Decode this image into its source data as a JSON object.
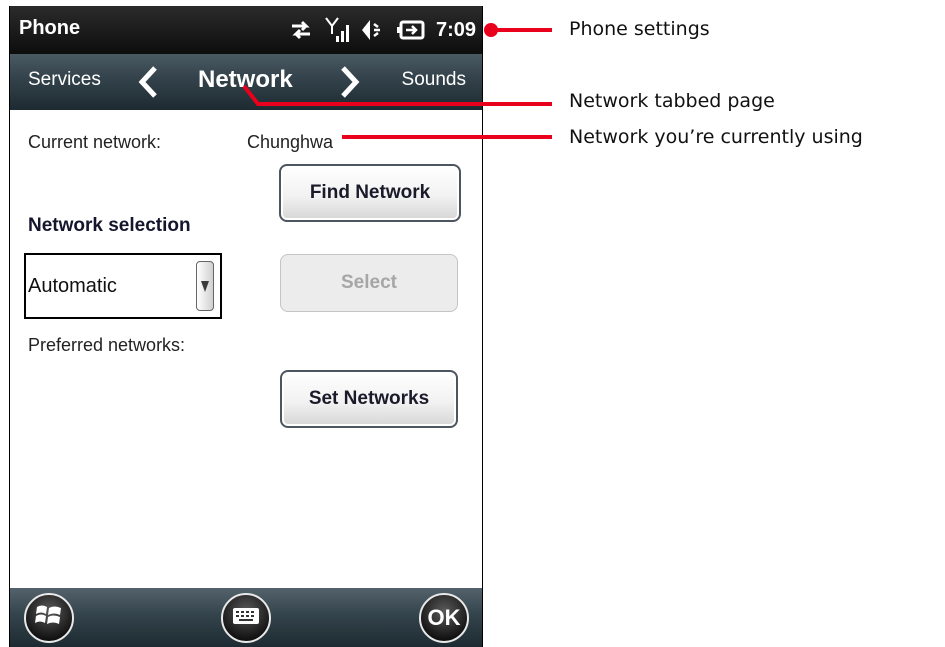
{
  "status_bar": {
    "title": "Phone",
    "time": "7:09",
    "icons": [
      "data-sync-icon",
      "signal-strength-icon",
      "speaker-icon",
      "battery-charging-icon"
    ]
  },
  "tab_bar": {
    "prev_tab": "Services",
    "current_tab": "Network",
    "next_tab": "Sounds"
  },
  "content": {
    "current_network_label": "Current network:",
    "current_network_value": "Chunghwa",
    "find_network_button": "Find Network",
    "network_selection_heading": "Network selection",
    "network_selection_value": "Automatic",
    "select_button": "Select",
    "preferred_networks_label": "Preferred networks:",
    "set_networks_button": "Set Networks"
  },
  "bottom_bar": {
    "ok_label": "OK",
    "icons": [
      "windows-start-icon",
      "keyboard-icon"
    ]
  },
  "callouts": {
    "phone_settings": "Phone settings",
    "network_tab": "Network tabbed page",
    "current_network": "Network you’re currently using"
  },
  "colors": {
    "callout_line": "#e8001c",
    "status_bar_bg": "#111111",
    "tab_bar_bg": "#33424a"
  }
}
